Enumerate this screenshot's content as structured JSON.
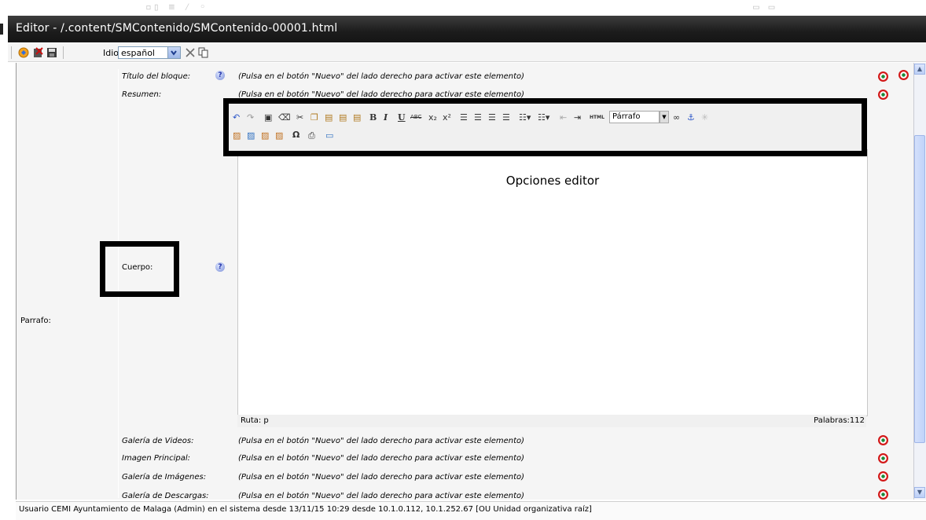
{
  "window": {
    "title": "Editor - /.content/SMContenido/SMContenido-00001.html"
  },
  "toolbar": {
    "language_label": "Idioma",
    "language_value": "español"
  },
  "section": {
    "label": "Parrafo:"
  },
  "fields": [
    {
      "label": "Título del bloque:",
      "message": "(Pulsa en el botón \"Nuevo\" del lado derecho para activar este elemento)"
    },
    {
      "label": "Resumen:",
      "message": "(Pulsa en el botón \"Nuevo\" del lado derecho para activar este elemento)"
    },
    {
      "label": "Cuerpo:"
    },
    {
      "label": "Galería de Videos:",
      "message": "(Pulsa en el botón \"Nuevo\" del lado derecho para activar este elemento)"
    },
    {
      "label": "Imagen Principal:",
      "message": "(Pulsa en el botón \"Nuevo\" del lado derecho para activar este elemento)"
    },
    {
      "label": "Galería de Imágenes:",
      "message": "(Pulsa en el botón \"Nuevo\" del lado derecho para activar este elemento)"
    },
    {
      "label": "Galería de Descargas:",
      "message": "(Pulsa en el botón \"Nuevo\" del lado derecho para activar este elemento)"
    }
  ],
  "editor": {
    "caption": "Opciones editor",
    "format_value": "Párrafo",
    "path": "Ruta: p",
    "word_count": "Palabras:112",
    "tools": {
      "bold": "B",
      "italic": "I",
      "underline": "U",
      "strike": "ABC",
      "subscript": "x₂",
      "superscript": "x²",
      "html": "HTML",
      "omega": "Ω"
    }
  },
  "status": {
    "text": "Usuario CEMI Ayuntamiento de Malaga (Admin) en el sistema desde 13/11/15 10:29 desde 10.1.0.112, 10.1.252.67 [OU Unidad organizativa raíz]"
  },
  "colors": {
    "titlebar": "#1c1c1c",
    "annotation_box": "#000000",
    "add_icon_ring": "#d21818"
  }
}
